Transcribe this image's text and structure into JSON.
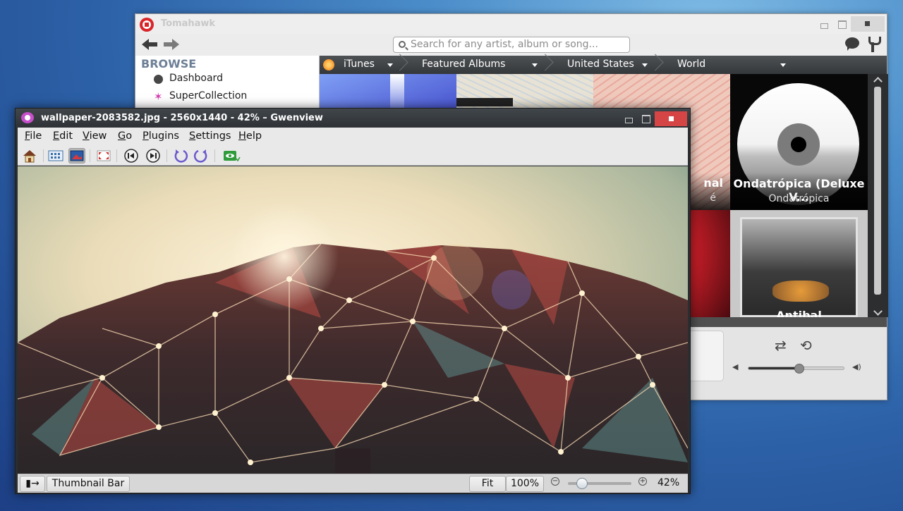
{
  "tomahawk": {
    "title": "Tomahawk",
    "search_placeholder": "Search for any artist, album or song...",
    "sidebar": {
      "heading": "BROWSE",
      "items": [
        {
          "label": "Dashboard",
          "icon": "dashboard-icon"
        },
        {
          "label": "SuperCollection",
          "icon": "supercollection-icon"
        }
      ]
    },
    "breadcrumbs": [
      "iTunes",
      "Featured Albums",
      "United States",
      "World"
    ],
    "albums": [
      {
        "title": "Ondatrópica (Deluxe V...",
        "artist": "Ondatrópica"
      }
    ],
    "partial_labels": {
      "album2_title_end": "nal",
      "album2_artist_end": "é",
      "album3_title_start": "Antibal"
    }
  },
  "gwenview": {
    "title": "wallpaper-2083582.jpg - 2560x1440 - 42% – Gwenview",
    "menu": [
      {
        "label": "File",
        "mnemonic": "F",
        "rest": "ile"
      },
      {
        "label": "Edit",
        "mnemonic": "E",
        "rest": "dit"
      },
      {
        "label": "View",
        "mnemonic": "V",
        "rest": "iew"
      },
      {
        "label": "Go",
        "mnemonic": "G",
        "rest": "o"
      },
      {
        "label": "Plugins",
        "mnemonic": "P",
        "rest": "lugins"
      },
      {
        "label": "Settings",
        "mnemonic": "S",
        "rest": "ettings"
      },
      {
        "label": "Help",
        "mnemonic": "H",
        "rest": "elp"
      }
    ],
    "statusbar": {
      "thumbnail_bar": "Thumbnail Bar",
      "fit": "Fit",
      "hundred": "100%",
      "zoom": "42%",
      "zoom_fraction": 0.22
    }
  },
  "colors": {
    "desktop": "#2d62a8",
    "gwenview_close": "#d64545",
    "tomahawk_red": "#d9262b",
    "breadcrumb_bar": "#3f4245"
  }
}
